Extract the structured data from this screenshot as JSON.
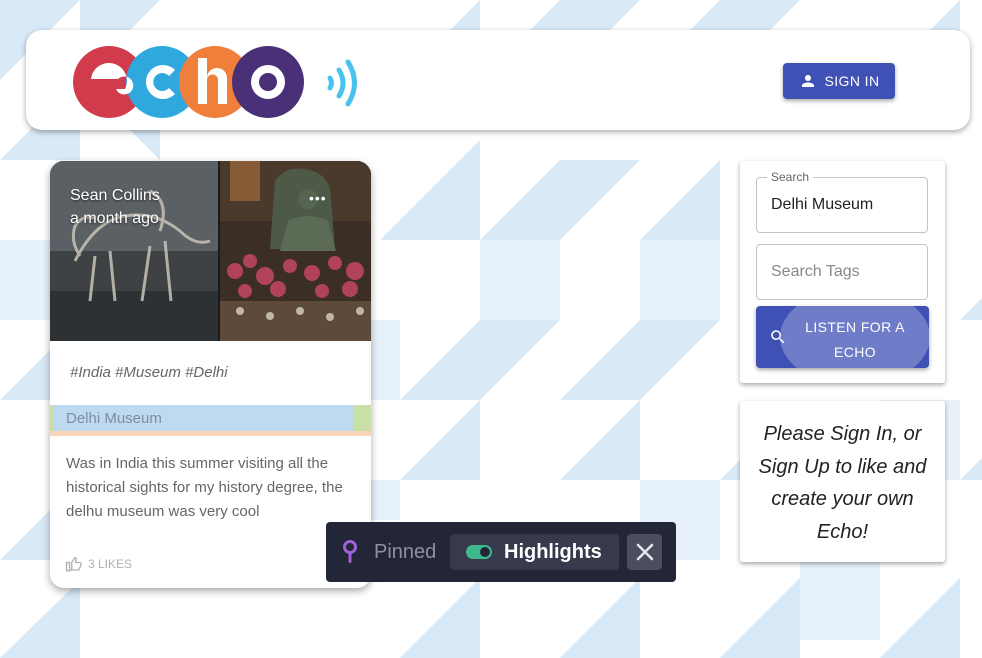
{
  "brand": {
    "logo_text": "echo",
    "logo_colors": [
      "#d13b4b",
      "#2fa8de",
      "#f07f3c",
      "#4a3076"
    ],
    "wave_color": "#49c2ee"
  },
  "header": {
    "signin_label": "SIGN IN",
    "signin_icon": "person-icon"
  },
  "echo_card": {
    "author": "Sean Collins",
    "time": "a month ago",
    "more_icon": "more-horizontal-icon",
    "tags": "#India #Museum #Delhi",
    "location": "Delhi Museum",
    "description": "Was in India this summer visiting all the historical sights for my history degree, the delhu museum was very cool",
    "likes": "3 LIKES",
    "likes_icon": "thumb-up-icon"
  },
  "search": {
    "label": "Search",
    "value": "Delhi Museum",
    "tags_placeholder": "Search Tags",
    "listen_label": "LISTEN FOR A ECHO",
    "listen_icon": "search-icon"
  },
  "signin_prompt": {
    "message": "Please Sign In, or Sign Up to like and create your own Echo!"
  },
  "pin_toolbar": {
    "pinned_label": "Pinned",
    "highlights_label": "Highlights",
    "highlights_enabled": true,
    "pin_color": "#a062d8",
    "toggle_color": "#3fb88a"
  },
  "colors": {
    "primary": "#3f51b5",
    "background_pattern": "#d8e9f7"
  }
}
